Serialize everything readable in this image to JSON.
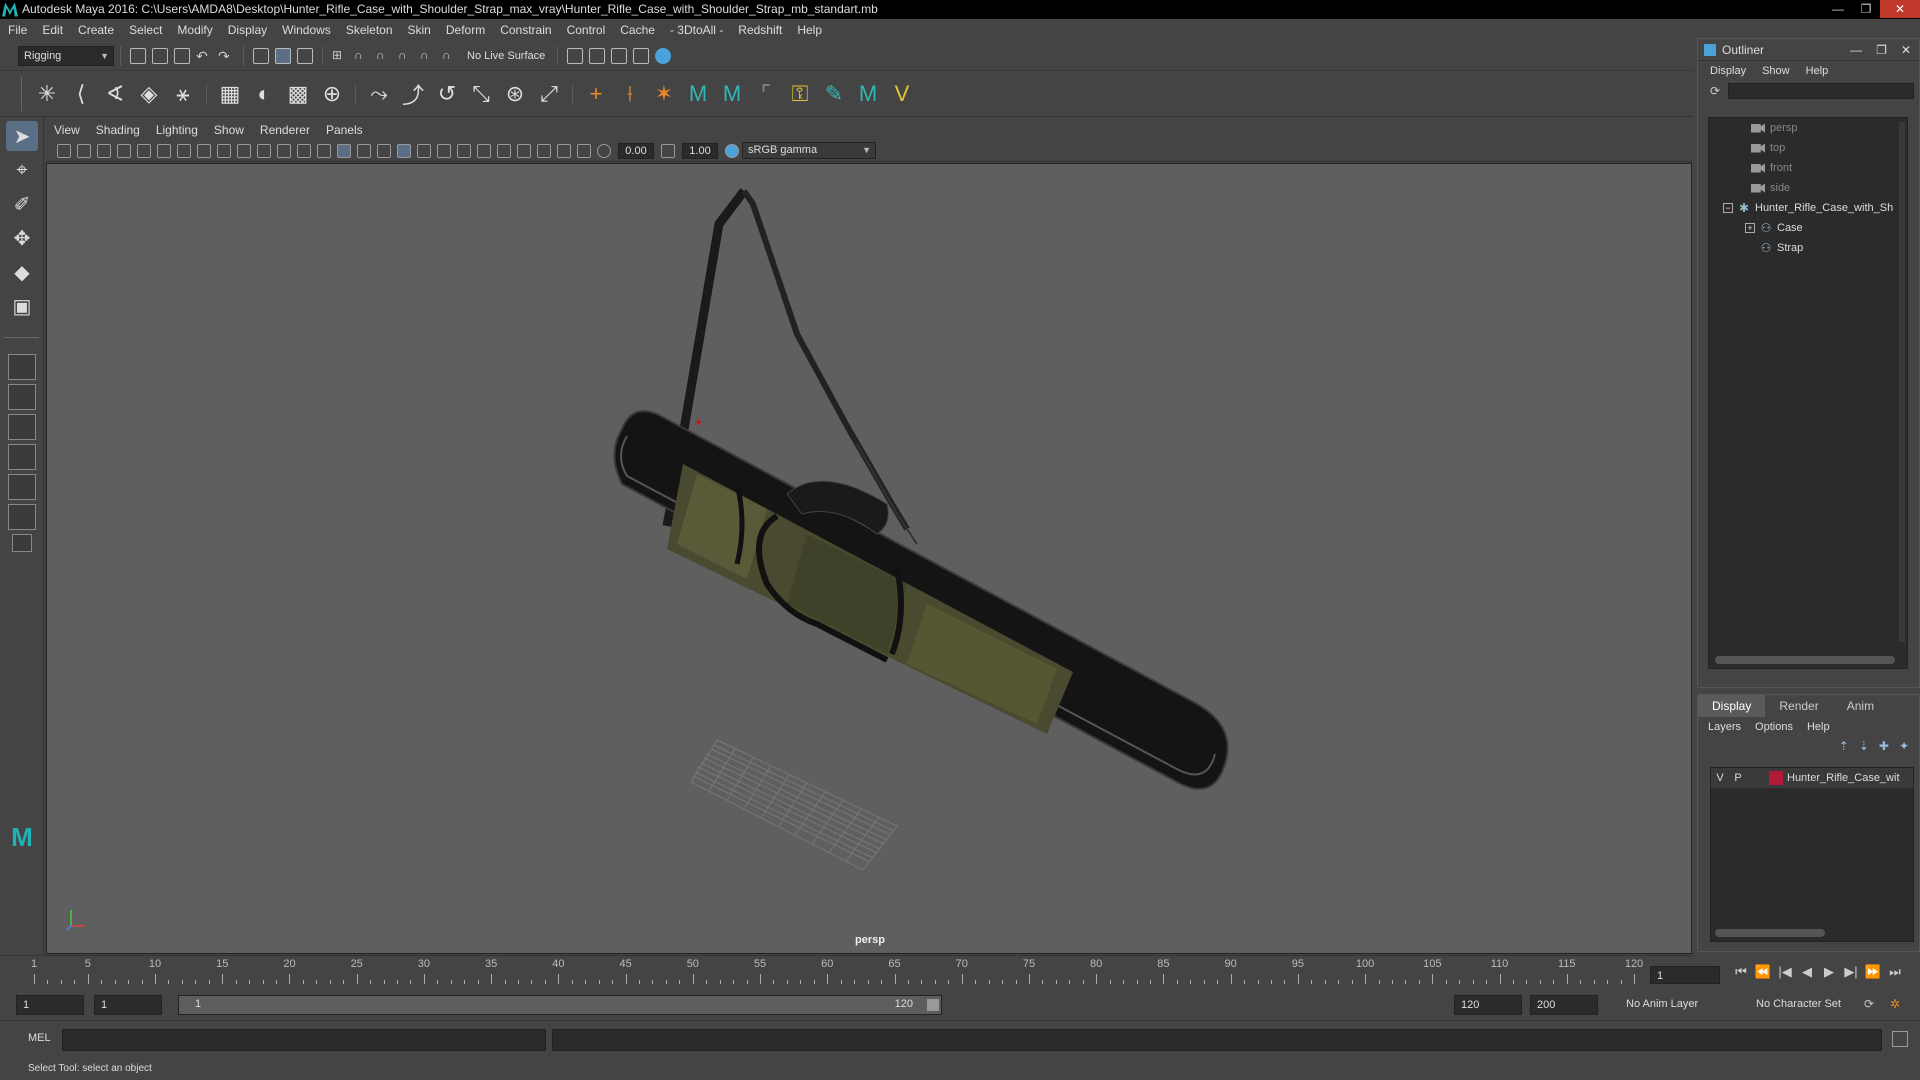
{
  "window": {
    "title": "Autodesk Maya 2016: C:\\Users\\AMDA8\\Desktop\\Hunter_Rifle_Case_with_Shoulder_Strap_max_vray\\Hunter_Rifle_Case_with_Shoulder_Strap_mb_standart.mb",
    "controls": [
      "—",
      "❐",
      "✕"
    ]
  },
  "menubar": [
    "File",
    "Edit",
    "Create",
    "Select",
    "Modify",
    "Display",
    "Windows",
    "Skeleton",
    "Skin",
    "Deform",
    "Constrain",
    "Control",
    "Cache",
    "- 3DtoAll -",
    "Redshift",
    "Help"
  ],
  "statusline": {
    "mode": "Rigging",
    "live_surface": "No Live Surface"
  },
  "panel": {
    "menu": [
      "View",
      "Shading",
      "Lighting",
      "Show",
      "Renderer",
      "Panels"
    ],
    "exposure": "0.00",
    "gamma": "1.00",
    "color_space": "sRGB gamma",
    "camera": "persp"
  },
  "timeline": {
    "ticks": [
      "1",
      "5",
      "10",
      "15",
      "20",
      "25",
      "30",
      "35",
      "40",
      "45",
      "50",
      "55",
      "60",
      "65",
      "70",
      "75",
      "80",
      "85",
      "90",
      "95",
      "100",
      "105",
      "110",
      "115",
      "120"
    ],
    "current_frame": "1",
    "playback": [
      "⏮",
      "⏪",
      "|◀",
      "◀",
      "▶",
      "▶|",
      "⏩",
      "⏭"
    ]
  },
  "range": {
    "start": "1",
    "playback_start": "1",
    "slider_start": "1",
    "slider_end": "120",
    "playback_end": "120",
    "end": "200",
    "anim_layer": "No Anim Layer",
    "character_set": "No Character Set"
  },
  "cmdline": {
    "label": "MEL"
  },
  "helpline": "Select Tool: select an object",
  "outliner": {
    "title": "Outliner",
    "controls": [
      "—",
      "❐",
      "✕"
    ],
    "menu": [
      "Display",
      "Show",
      "Help"
    ],
    "items": [
      {
        "label": "persp",
        "type": "camera"
      },
      {
        "label": "top",
        "type": "camera"
      },
      {
        "label": "front",
        "type": "camera"
      },
      {
        "label": "side",
        "type": "camera"
      },
      {
        "label": "Hunter_Rifle_Case_with_Sh",
        "type": "root"
      },
      {
        "label": "Case",
        "type": "child"
      },
      {
        "label": "Strap",
        "type": "child"
      }
    ]
  },
  "layers": {
    "tabs": [
      "Display",
      "Render",
      "Anim"
    ],
    "menu": [
      "Layers",
      "Options",
      "Help"
    ],
    "row": {
      "v": "V",
      "p": "P",
      "name": "Hunter_Rifle_Case_wit",
      "color": "#b01c38"
    }
  }
}
